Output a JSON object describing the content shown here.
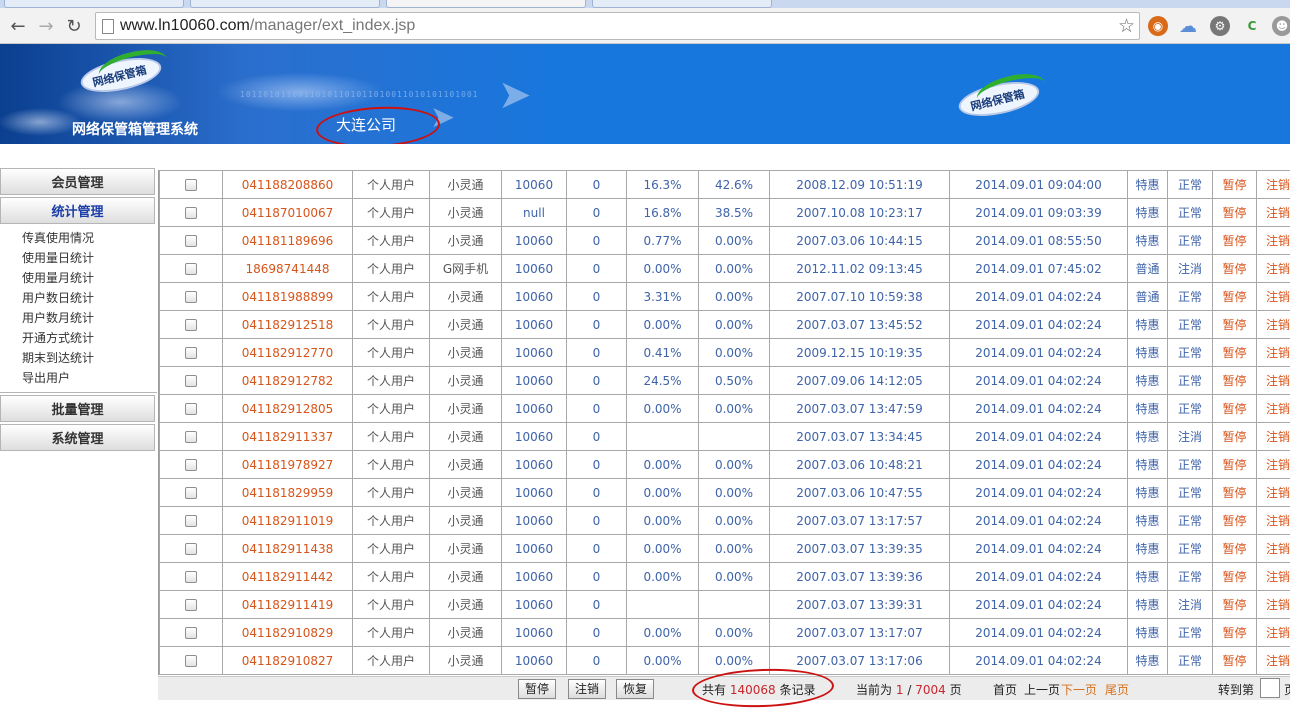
{
  "browser": {
    "url_host": "www.ln10060.com",
    "url_path": "/manager/ext_index.jsp"
  },
  "header": {
    "system_title": "网络保管箱管理系统",
    "company": "大连公司",
    "logo_text": "网络保管箱"
  },
  "sidebar": {
    "menus": [
      {
        "label": "会员管理",
        "active": false
      },
      {
        "label": "统计管理",
        "active": true
      },
      {
        "label": "批量管理",
        "active": false
      },
      {
        "label": "系统管理",
        "active": false
      }
    ],
    "stats_items": [
      "传真使用情况",
      "使用量日统计",
      "使用量月统计",
      "用户数日统计",
      "用户数月统计",
      "开通方式统计",
      "期末到达统计",
      "导出用户"
    ]
  },
  "table": {
    "rows": [
      [
        "041188208860",
        "个人用户",
        "小灵通",
        "10060",
        "0",
        "16.3%",
        "42.6%",
        "2008.12.09 10:51:19",
        "2014.09.01 09:04:00",
        "特惠",
        "正常",
        "暂停",
        "注销"
      ],
      [
        "041187010067",
        "个人用户",
        "小灵通",
        "null",
        "0",
        "16.8%",
        "38.5%",
        "2007.10.08 10:23:17",
        "2014.09.01 09:03:39",
        "特惠",
        "正常",
        "暂停",
        "注销"
      ],
      [
        "041181189696",
        "个人用户",
        "小灵通",
        "10060",
        "0",
        "0.77%",
        "0.00%",
        "2007.03.06 10:44:15",
        "2014.09.01 08:55:50",
        "特惠",
        "正常",
        "暂停",
        "注销"
      ],
      [
        "18698741448",
        "个人用户",
        "G网手机",
        "10060",
        "0",
        "0.00%",
        "0.00%",
        "2012.11.02 09:13:45",
        "2014.09.01 07:45:02",
        "普通",
        "注消",
        "暂停",
        "注销"
      ],
      [
        "041181988899",
        "个人用户",
        "小灵通",
        "10060",
        "0",
        "3.31%",
        "0.00%",
        "2007.07.10 10:59:38",
        "2014.09.01 04:02:24",
        "普通",
        "正常",
        "暂停",
        "注销"
      ],
      [
        "041182912518",
        "个人用户",
        "小灵通",
        "10060",
        "0",
        "0.00%",
        "0.00%",
        "2007.03.07 13:45:52",
        "2014.09.01 04:02:24",
        "特惠",
        "正常",
        "暂停",
        "注销"
      ],
      [
        "041182912770",
        "个人用户",
        "小灵通",
        "10060",
        "0",
        "0.41%",
        "0.00%",
        "2009.12.15 10:19:35",
        "2014.09.01 04:02:24",
        "特惠",
        "正常",
        "暂停",
        "注销"
      ],
      [
        "041182912782",
        "个人用户",
        "小灵通",
        "10060",
        "0",
        "24.5%",
        "0.50%",
        "2007.09.06 14:12:05",
        "2014.09.01 04:02:24",
        "特惠",
        "正常",
        "暂停",
        "注销"
      ],
      [
        "041182912805",
        "个人用户",
        "小灵通",
        "10060",
        "0",
        "0.00%",
        "0.00%",
        "2007.03.07 13:47:59",
        "2014.09.01 04:02:24",
        "特惠",
        "正常",
        "暂停",
        "注销"
      ],
      [
        "041182911337",
        "个人用户",
        "小灵通",
        "10060",
        "0",
        "",
        "",
        "2007.03.07 13:34:45",
        "2014.09.01 04:02:24",
        "特惠",
        "注消",
        "暂停",
        "注销"
      ],
      [
        "041181978927",
        "个人用户",
        "小灵通",
        "10060",
        "0",
        "0.00%",
        "0.00%",
        "2007.03.06 10:48:21",
        "2014.09.01 04:02:24",
        "特惠",
        "正常",
        "暂停",
        "注销"
      ],
      [
        "041181829959",
        "个人用户",
        "小灵通",
        "10060",
        "0",
        "0.00%",
        "0.00%",
        "2007.03.06 10:47:55",
        "2014.09.01 04:02:24",
        "特惠",
        "正常",
        "暂停",
        "注销"
      ],
      [
        "041182911019",
        "个人用户",
        "小灵通",
        "10060",
        "0",
        "0.00%",
        "0.00%",
        "2007.03.07 13:17:57",
        "2014.09.01 04:02:24",
        "特惠",
        "正常",
        "暂停",
        "注销"
      ],
      [
        "041182911438",
        "个人用户",
        "小灵通",
        "10060",
        "0",
        "0.00%",
        "0.00%",
        "2007.03.07 13:39:35",
        "2014.09.01 04:02:24",
        "特惠",
        "正常",
        "暂停",
        "注销"
      ],
      [
        "041182911442",
        "个人用户",
        "小灵通",
        "10060",
        "0",
        "0.00%",
        "0.00%",
        "2007.03.07 13:39:36",
        "2014.09.01 04:02:24",
        "特惠",
        "正常",
        "暂停",
        "注销"
      ],
      [
        "041182911419",
        "个人用户",
        "小灵通",
        "10060",
        "0",
        "",
        "",
        "2007.03.07 13:39:31",
        "2014.09.01 04:02:24",
        "特惠",
        "注消",
        "暂停",
        "注销"
      ],
      [
        "041182910829",
        "个人用户",
        "小灵通",
        "10060",
        "0",
        "0.00%",
        "0.00%",
        "2007.03.07 13:17:07",
        "2014.09.01 04:02:24",
        "特惠",
        "正常",
        "暂停",
        "注销"
      ],
      [
        "041182910827",
        "个人用户",
        "小灵通",
        "10060",
        "0",
        "0.00%",
        "0.00%",
        "2007.03.07 13:17:06",
        "2014.09.01 04:02:24",
        "特惠",
        "正常",
        "暂停",
        "注销"
      ]
    ]
  },
  "footer": {
    "btn_pause": "暂停",
    "btn_cancel": "注销",
    "btn_restore": "恢复",
    "total_prefix": "共有",
    "total_count": "140068",
    "total_suffix": "条记录",
    "current_prefix": "当前为",
    "current_page": "1",
    "page_sep": "/",
    "total_pages": "7004",
    "page_suffix": "页",
    "first_page": "首页",
    "prev_page": "上一页",
    "next_page": "下一页",
    "last_page": "尾页",
    "goto_label": "转到第",
    "goto_suffix": "页"
  },
  "colors": {
    "header_blue": "#1877dd",
    "link_orange": "#d7541a",
    "text_blue": "#3e63a9",
    "annotation_red": "#cc1111"
  }
}
